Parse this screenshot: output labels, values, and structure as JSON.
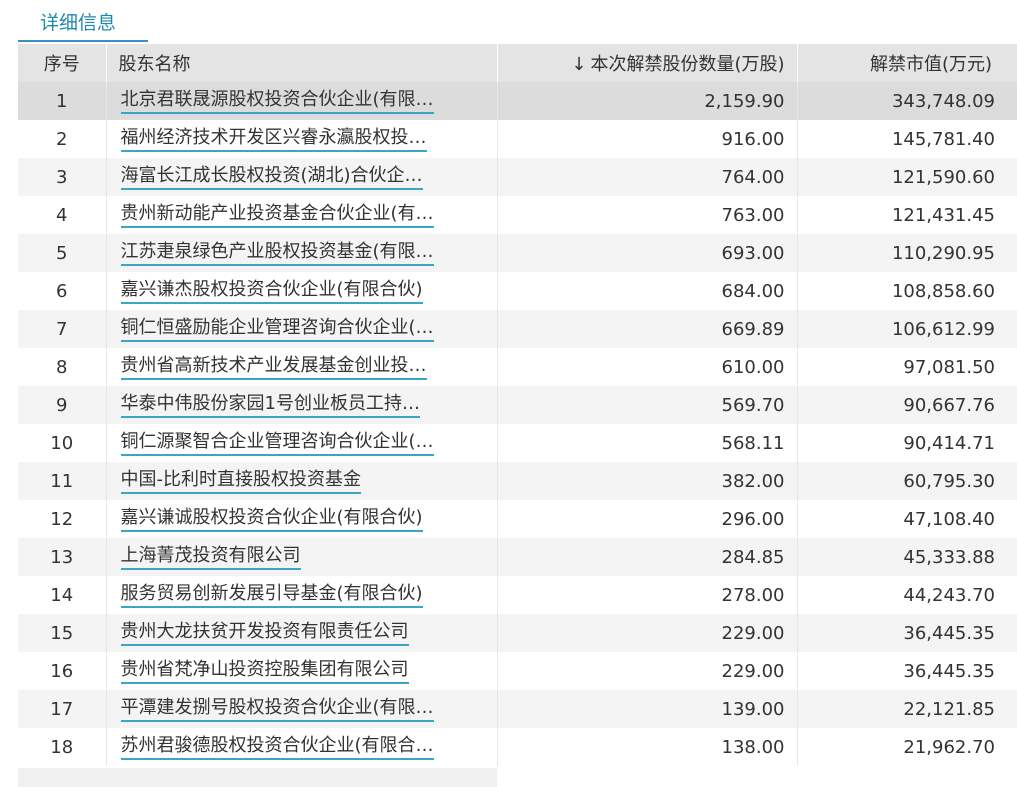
{
  "tab": {
    "label": "详细信息"
  },
  "table": {
    "headers": {
      "index": "序号",
      "holder": "股东名称",
      "quantity": "本次解禁股份数量(万股)",
      "value": "解禁市值(万元)"
    },
    "sort_icon": "arrow-down-icon",
    "rows": [
      {
        "index": "1",
        "holder": "北京君联晟源股权投资合伙企业(有限…",
        "quantity": "2,159.90",
        "value": "343,748.09"
      },
      {
        "index": "2",
        "holder": "福州经济技术开发区兴睿永瀛股权投…",
        "quantity": "916.00",
        "value": "145,781.40"
      },
      {
        "index": "3",
        "holder": "海富长江成长股权投资(湖北)合伙企…",
        "quantity": "764.00",
        "value": "121,590.60"
      },
      {
        "index": "4",
        "holder": "贵州新动能产业投资基金合伙企业(有…",
        "quantity": "763.00",
        "value": "121,431.45"
      },
      {
        "index": "5",
        "holder": "江苏疌泉绿色产业股权投资基金(有限…",
        "quantity": "693.00",
        "value": "110,290.95"
      },
      {
        "index": "6",
        "holder": "嘉兴谦杰股权投资合伙企业(有限合伙)",
        "quantity": "684.00",
        "value": "108,858.60"
      },
      {
        "index": "7",
        "holder": "铜仁恒盛励能企业管理咨询合伙企业(…",
        "quantity": "669.89",
        "value": "106,612.99"
      },
      {
        "index": "8",
        "holder": "贵州省高新技术产业发展基金创业投…",
        "quantity": "610.00",
        "value": "97,081.50"
      },
      {
        "index": "9",
        "holder": "华泰中伟股份家园1号创业板员工持…",
        "quantity": "569.70",
        "value": "90,667.76"
      },
      {
        "index": "10",
        "holder": "铜仁源聚智合企业管理咨询合伙企业(…",
        "quantity": "568.11",
        "value": "90,414.71"
      },
      {
        "index": "11",
        "holder": "中国-比利时直接股权投资基金",
        "quantity": "382.00",
        "value": "60,795.30"
      },
      {
        "index": "12",
        "holder": "嘉兴谦诚股权投资合伙企业(有限合伙)",
        "quantity": "296.00",
        "value": "47,108.40"
      },
      {
        "index": "13",
        "holder": "上海菁茂投资有限公司",
        "quantity": "284.85",
        "value": "45,333.88"
      },
      {
        "index": "14",
        "holder": "服务贸易创新发展引导基金(有限合伙)",
        "quantity": "278.00",
        "value": "44,243.70"
      },
      {
        "index": "15",
        "holder": "贵州大龙扶贫开发投资有限责任公司",
        "quantity": "229.00",
        "value": "36,445.35"
      },
      {
        "index": "16",
        "holder": "贵州省梵净山投资控股集团有限公司",
        "quantity": "229.00",
        "value": "36,445.35"
      },
      {
        "index": "17",
        "holder": "平潭建发捌号股权投资合伙企业(有限…",
        "quantity": "139.00",
        "value": "22,121.85"
      },
      {
        "index": "18",
        "holder": "苏州君骏德股权投资合伙企业(有限合…",
        "quantity": "138.00",
        "value": "21,962.70"
      }
    ]
  },
  "colors": {
    "tab_text": "#1f8ab0",
    "link_underline": "#3aa5c4",
    "header_bg": "#e4e4e4",
    "selected_row_bg": "#dcdcdc"
  }
}
